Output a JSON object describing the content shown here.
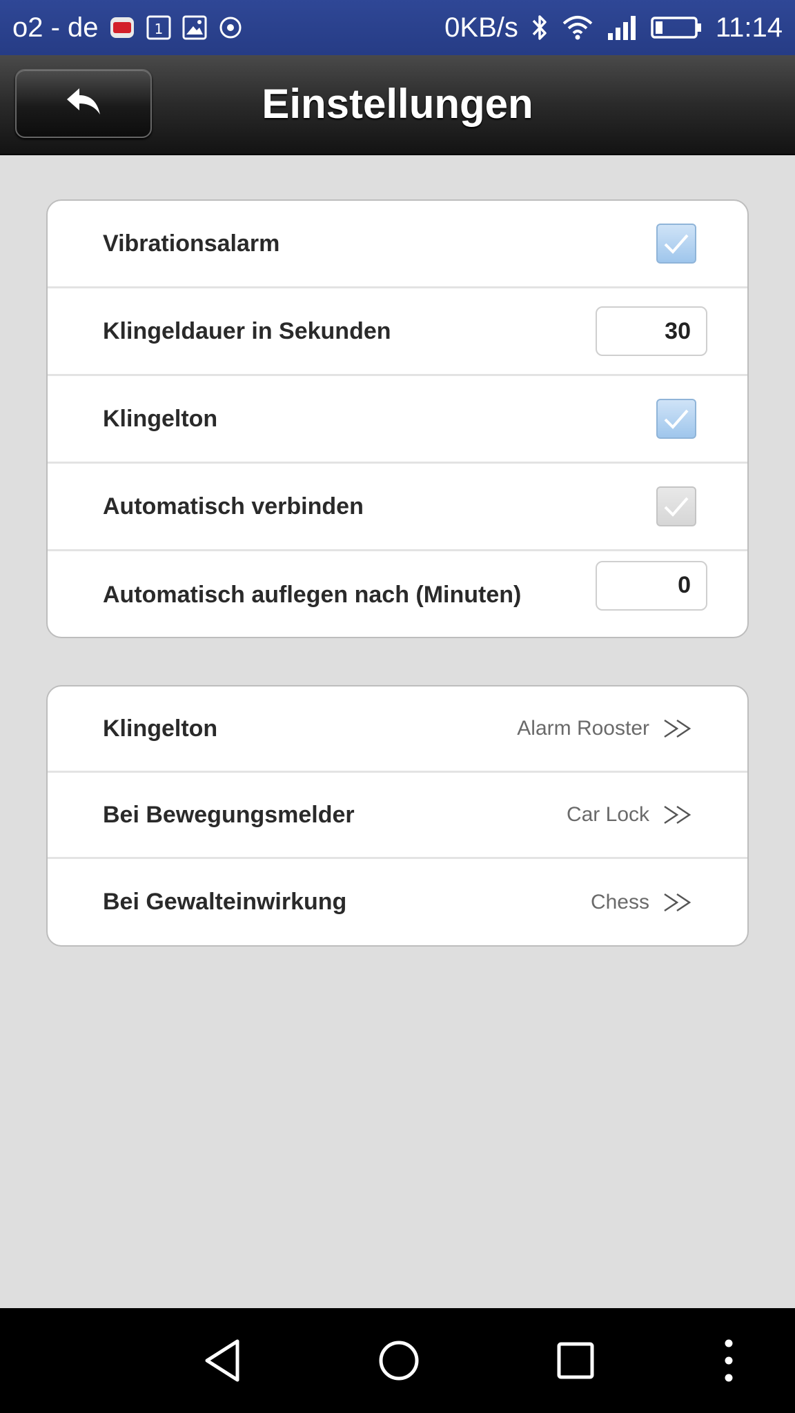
{
  "status_bar": {
    "carrier": "o2 - de",
    "network_speed": "0KB/s",
    "time": "11:14",
    "icons": [
      "app-notification-icon",
      "sim-icon",
      "image-icon",
      "sync-icon",
      "bluetooth-icon",
      "wifi-icon",
      "signal-icon",
      "battery-icon"
    ]
  },
  "header": {
    "title": "Einstellungen",
    "back_icon": "back-arrow-icon"
  },
  "settings_group": {
    "rows": [
      {
        "label": "Vibrationsalarm",
        "control": "checkbox",
        "checked": true,
        "enabled": true
      },
      {
        "label": "Klingeldauer in Sekunden",
        "control": "number",
        "value": "30"
      },
      {
        "label": "Klingelton",
        "control": "checkbox",
        "checked": true,
        "enabled": true
      },
      {
        "label": "Automatisch verbinden",
        "control": "checkbox",
        "checked": true,
        "enabled": false
      },
      {
        "label": "Automatisch auflegen nach (Minuten)",
        "control": "number",
        "value": "0"
      }
    ]
  },
  "sound_group": {
    "rows": [
      {
        "label": "Klingelton",
        "value": "Alarm Rooster"
      },
      {
        "label": "Bei Bewegungsmelder",
        "value": "Car Lock"
      },
      {
        "label": "Bei Gewalteinwirkung",
        "value": "Chess"
      }
    ]
  },
  "nav_bar": {
    "icons": [
      "back-triangle-icon",
      "home-circle-icon",
      "recents-square-icon",
      "overflow-menu-icon"
    ]
  },
  "colors": {
    "status_bar": "#2b4290",
    "checkbox_fill": "#b6d4f2",
    "background": "#dedede"
  }
}
